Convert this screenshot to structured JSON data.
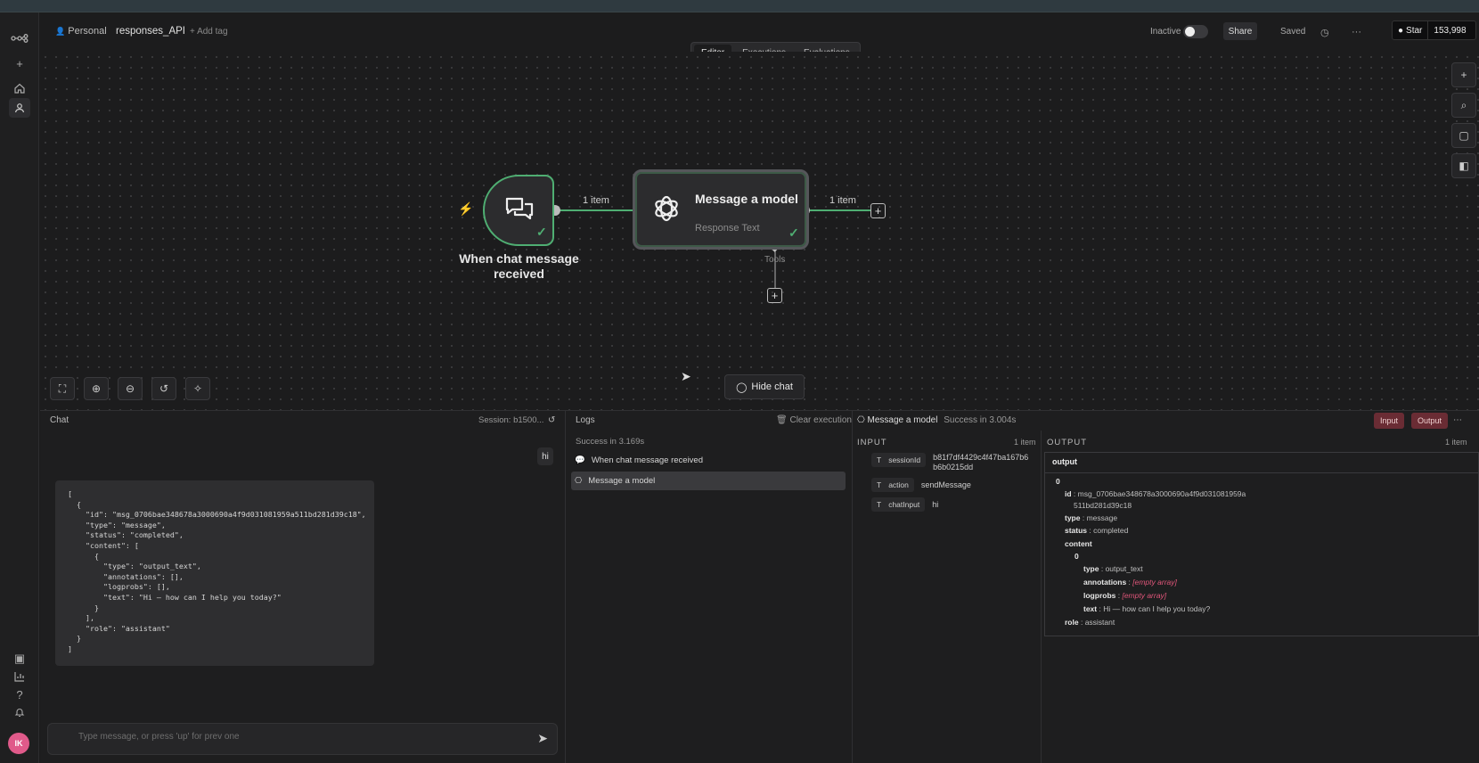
{
  "header": {
    "project": "Personal",
    "workflow_name": "responses_API",
    "add_tag": "+ Add tag",
    "tabs": [
      "Editor",
      "Executions",
      "Evaluations"
    ],
    "status": "Inactive",
    "share": "Share",
    "saved": "Saved",
    "star_label": "Star",
    "star_count": "153,998"
  },
  "canvas": {
    "trigger_label": "When chat message received",
    "conn1_label": "1 item",
    "ai_title": "Message a model",
    "ai_subtitle": "Response Text",
    "conn2_label": "1 item",
    "tools_label": "Tools",
    "hide_chat": "Hide chat"
  },
  "chat": {
    "title": "Chat",
    "session": "Session: b1500...",
    "user_message": "hi",
    "bot_json": "[\n  {\n    \"id\": \"msg_0706bae348678a3000690a4f9d031081959a511bd281d39c18\",\n    \"type\": \"message\",\n    \"status\": \"completed\",\n    \"content\": [\n      {\n        \"type\": \"output_text\",\n        \"annotations\": [],\n        \"logprobs\": [],\n        \"text\": \"Hi — how can I help you today?\"\n      }\n    ],\n    \"role\": \"assistant\"\n  }\n]",
    "input_placeholder": "Type message, or press 'up' for prev one"
  },
  "logs": {
    "title": "Logs",
    "clear": "Clear execution",
    "success": "Success in 3.169s",
    "items": [
      "When chat message received",
      "Message a model"
    ]
  },
  "detail": {
    "node_name": "Message a model",
    "status": "Success in 3.004s",
    "input_btn": "Input",
    "output_btn": "Output",
    "input_title": "INPUT",
    "input_count": "1 item",
    "output_title": "OUTPUT",
    "output_count": "1 item",
    "input_fields": [
      {
        "key": "sessionId",
        "value": "b81f7df4429c4f47ba167b6b6b0215dd"
      },
      {
        "key": "action",
        "value": "sendMessage"
      },
      {
        "key": "chatInput",
        "value": "hi"
      }
    ],
    "output": {
      "root": "output",
      "index0": "0",
      "id_key": "id",
      "id_val_1": "msg_0706bae348678a3000690a4f9d031081959a",
      "id_val_2": "511bd281d39c18",
      "type_key": "type",
      "type_val": "message",
      "status_key": "status",
      "status_val": "completed",
      "content_key": "content",
      "content_index": "0",
      "ctype_key": "type",
      "ctype_val": "output_text",
      "ann_key": "annotations",
      "ann_val": "[empty array]",
      "logprobs_key": "logprobs",
      "logprobs_val": "[empty array]",
      "text_key": "text",
      "text_val": "Hi — how can I help you today?",
      "role_key": "role",
      "role_val": "assistant"
    }
  },
  "colors": {
    "success_green": "#4fae72",
    "accent_red": "#e0567a",
    "avatar_pink": "#e05a8a"
  },
  "user": {
    "initials": "IK"
  }
}
